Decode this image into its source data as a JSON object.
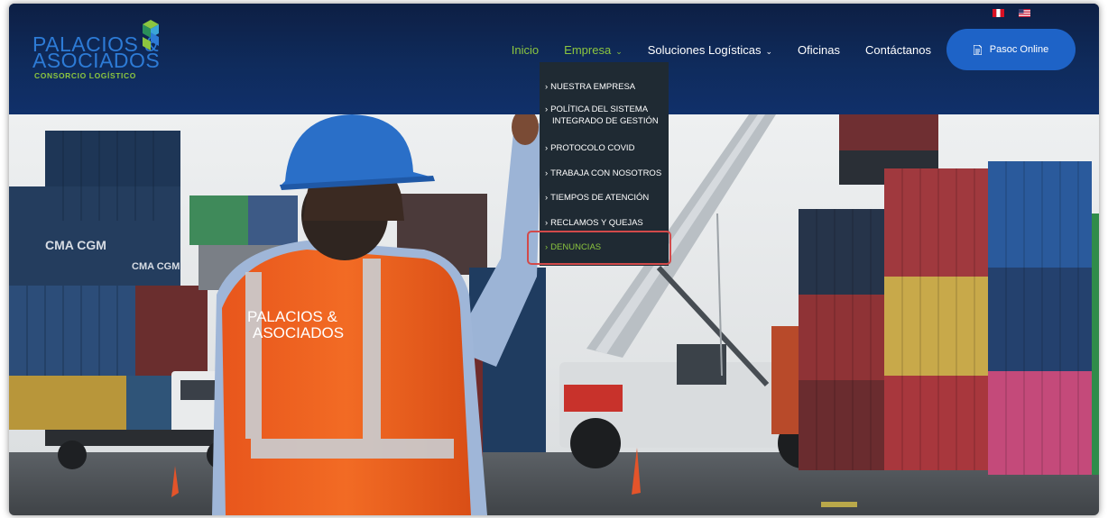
{
  "brand": {
    "logo_line1": "PALACIOS &",
    "logo_line2": "ASOCIADOS",
    "logo_tagline": "CONSORCIO LOGÍSTICO"
  },
  "nav": {
    "items": [
      {
        "label": "Inicio",
        "state": "active"
      },
      {
        "label": "Empresa",
        "state": "open",
        "caret": "chevron-down-icon"
      },
      {
        "label": "Soluciones Logísticas",
        "caret": "chevron-down-icon"
      },
      {
        "label": "Oficinas"
      },
      {
        "label": "Contáctanos"
      }
    ],
    "cta_label": "Pasoc Online"
  },
  "dropdown": {
    "items": [
      {
        "label": "NUESTRA EMPRESA"
      },
      {
        "label": "POLÍTICA DEL SISTEMA INTEGRADO DE GESTIÓN"
      },
      {
        "label": "PROTOCOLO COVID"
      },
      {
        "label": "TRABAJA CON NOSOTROS"
      },
      {
        "label": "TIEMPOS DE ATENCIÓN"
      },
      {
        "label": "RECLAMOS Y QUEJAS"
      },
      {
        "label": "DENUNCIAS",
        "state": "highlighted"
      }
    ]
  },
  "hero": {
    "vest_line1": "PALACIOS &",
    "vest_line2": "ASOCIADOS",
    "container_text": "CMA CGM"
  },
  "colors": {
    "header_bg": "#0f2b5c",
    "accent_green": "#8cc63f",
    "brand_blue": "#2d7bd6",
    "cta_blue": "#1e63c7",
    "dropdown_bg": "#1f2a33",
    "highlight_red": "#d24a4a"
  }
}
